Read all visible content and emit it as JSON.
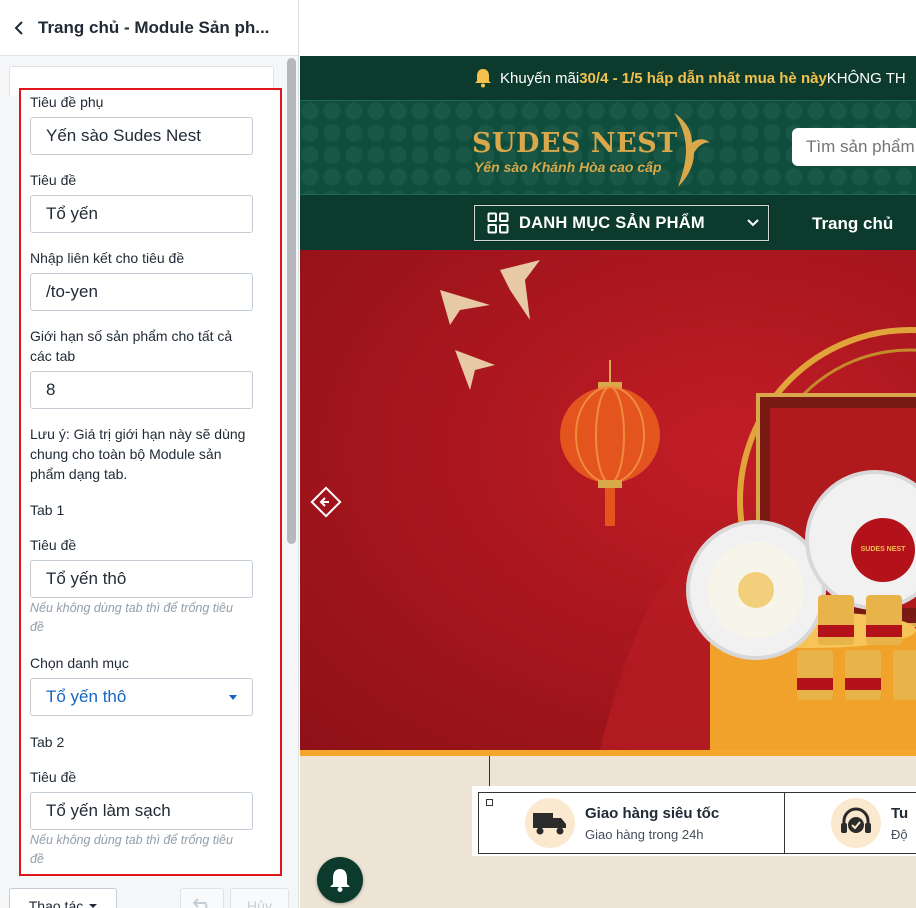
{
  "editor": {
    "title": "Trang chủ - Module Sản ph...",
    "fields": {
      "subtitle_label": "Tiêu đề phụ",
      "subtitle_value": "Yến sào Sudes Nest",
      "title_label": "Tiêu đề",
      "title_value": "Tổ yến",
      "link_label": "Nhập liên kết cho tiêu đề",
      "link_value": "/to-yen",
      "limit_label_line1": "Giới hạn số sản phẩm cho tất cả",
      "limit_label_line2": "các tab",
      "limit_value": "8",
      "note_line1": "Lưu ý: Giá trị giới hạn này sẽ dùng",
      "note_line2": "chung cho toàn bộ Module sản",
      "note_line3": "phẩm dạng tab."
    },
    "tab1": {
      "heading": "Tab 1",
      "title_label": "Tiêu đề",
      "title_value": "Tổ yến thô",
      "hint_line1": "Nếu không dùng tab thì để trống tiêu",
      "hint_line2": "đề",
      "category_label": "Chọn danh mục",
      "category_value": "Tổ yến thô"
    },
    "tab2": {
      "heading": "Tab 2",
      "title_label": "Tiêu đề",
      "title_value": "Tổ yến làm sạch",
      "hint_line1": "Nếu không dùng tab thì để trống tiêu",
      "hint_line2": "đề"
    },
    "bottom": {
      "actions_label": "Thao tác",
      "cancel_label": "Hủy"
    }
  },
  "preview": {
    "promo": {
      "prefix": "Khuyến mãi ",
      "highlight": "30/4 - 1/5 hấp dẫn nhất mua hè này",
      "suffix": " KHÔNG TH"
    },
    "logo": {
      "brand": "SUDES NEST",
      "tagline": "Yến sào Khánh Hòa cao cấp"
    },
    "search_placeholder": "Tìm sản phẩm",
    "nav": {
      "category_label": "DANH MỤC SẢN PHẨM",
      "home_label": "Trang chủ"
    },
    "banner": {
      "box_brand": "SUDES NEST"
    },
    "features": [
      {
        "title": "Giao hàng siêu tốc",
        "subtitle": "Giao hàng trong 24h"
      },
      {
        "title": "Tu",
        "subtitle": "Độ"
      }
    ]
  },
  "colors": {
    "brand_green": "#0c3b2e",
    "brand_gold": "#d9a84a",
    "banner_red": "#a8161e",
    "highlight_border": "#e0141b",
    "link_blue": "#1565c0"
  }
}
